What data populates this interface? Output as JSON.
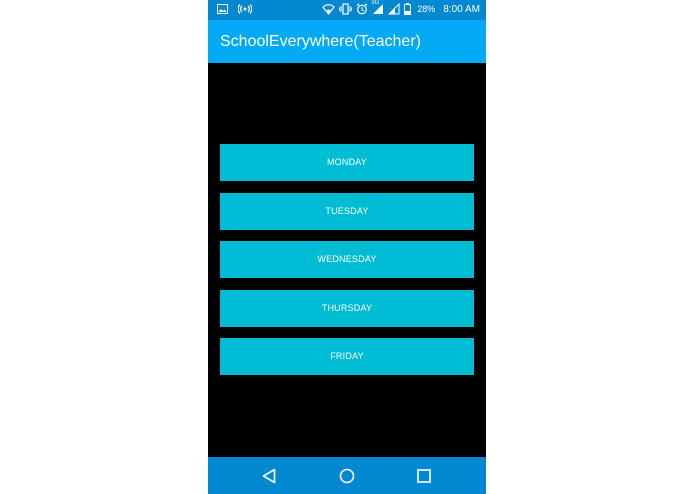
{
  "status_bar": {
    "battery_percent": "28%",
    "time": "8:00 AM",
    "network_label": "3G",
    "icons": [
      "image-icon",
      "hotspot-icon",
      "wifi-icon",
      "vibrate-icon",
      "alarm-icon",
      "signal-icon",
      "battery-icon"
    ]
  },
  "app_bar": {
    "title": "SchoolEverywhere(Teacher)"
  },
  "days": [
    {
      "label": "MONDAY"
    },
    {
      "label": "TUESDAY"
    },
    {
      "label": "WEDNESDAY"
    },
    {
      "label": "THURSDAY"
    },
    {
      "label": "FRIDAY"
    }
  ],
  "nav_bar": {
    "icons": [
      "back-icon",
      "home-icon",
      "recents-icon"
    ]
  },
  "colors": {
    "status_bar": "#0288d1",
    "app_bar": "#03a9f4",
    "button": "#00bcd4",
    "background": "#000000"
  }
}
